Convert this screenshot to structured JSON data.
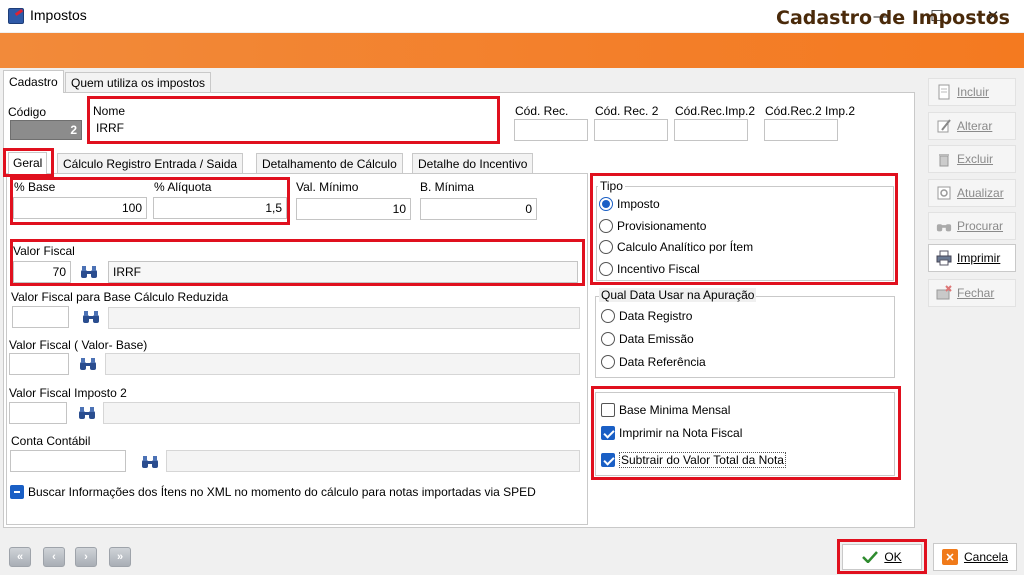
{
  "window": {
    "title": "Impostos",
    "minimize": "—",
    "maximize": "☐",
    "close": "✕"
  },
  "header": {
    "title": "Cadastro de Impostos"
  },
  "main_tabs": [
    {
      "label": "Cadastro"
    },
    {
      "label": "Quem utiliza os impostos"
    }
  ],
  "codigo": {
    "label": "Código",
    "value": "2"
  },
  "nome": {
    "label": "Nome",
    "value": "IRRF"
  },
  "codes": [
    {
      "label": "Cód. Rec."
    },
    {
      "label": "Cód. Rec. 2"
    },
    {
      "label": "Cód.Rec.Imp.2"
    },
    {
      "label": "Cód.Rec.2 Imp.2"
    }
  ],
  "sub_tabs": [
    {
      "label": "Geral"
    },
    {
      "label": "Cálculo Registro Entrada / Saida"
    },
    {
      "label": "Detalhamento de Cálculo"
    },
    {
      "label": "Detalhe do Incentivo"
    }
  ],
  "geral": {
    "base": {
      "label": "% Base",
      "value": "100"
    },
    "aliquota": {
      "label": "% Alíquota",
      "value": "1,5"
    },
    "val_minimo": {
      "label": "Val. Mínimo",
      "value": "10"
    },
    "b_minima": {
      "label": "B. Mínima",
      "value": "0"
    },
    "valor_fiscal": {
      "label": "Valor Fiscal",
      "code": "70",
      "desc": "IRRF"
    },
    "vf_base_reduzida": {
      "label": "Valor Fiscal para Base Cálculo Reduzida",
      "code": "",
      "desc": ""
    },
    "vf_valor_base": {
      "label": "Valor Fiscal ( Valor- Base)",
      "code": "",
      "desc": ""
    },
    "vf_imposto2": {
      "label": "Valor Fiscal Imposto 2",
      "code": "",
      "desc": ""
    },
    "conta_contabil": {
      "label": "Conta Contábil",
      "code": "",
      "desc": ""
    },
    "buscar_xml": {
      "label": "Buscar Informações dos Ítens no XML no momento do cálculo para notas importadas via SPED",
      "checked": true
    }
  },
  "tipo": {
    "title": "Tipo",
    "options": [
      {
        "label": "Imposto",
        "selected": true
      },
      {
        "label": "Provisionamento",
        "selected": false
      },
      {
        "label": "Calculo Analítico por Ítem",
        "selected": false
      },
      {
        "label": "Incentivo Fiscal",
        "selected": false
      }
    ]
  },
  "data_apuracao": {
    "title": "Qual Data Usar na Apuração",
    "options": [
      {
        "label": "Data Registro",
        "selected": false
      },
      {
        "label": "Data Emissão",
        "selected": false
      },
      {
        "label": "Data Referência",
        "selected": false
      }
    ]
  },
  "flags": [
    {
      "label": "Base Minima Mensal",
      "checked": false
    },
    {
      "label": "Imprimir na Nota Fiscal",
      "checked": true
    },
    {
      "label": "Subtrair do Valor Total da Nota",
      "checked": true
    }
  ],
  "side_buttons": [
    {
      "label": "Incluir",
      "icon": "document-icon",
      "enabled": false
    },
    {
      "label": "Alterar",
      "icon": "edit-icon",
      "enabled": false
    },
    {
      "label": "Excluir",
      "icon": "trash-icon",
      "enabled": false
    },
    {
      "label": "Atualizar",
      "icon": "refresh-icon",
      "enabled": false
    },
    {
      "label": "Procurar",
      "icon": "binoculars-icon",
      "enabled": false
    },
    {
      "label": "Imprimir",
      "icon": "printer-icon",
      "enabled": true
    },
    {
      "label": "Fechar",
      "icon": "close-folder-icon",
      "enabled": false
    }
  ],
  "nav": {
    "first": "«",
    "prev": "‹",
    "next": "›",
    "last": "»"
  },
  "footer": {
    "ok": "OK",
    "cancel": "Cancela"
  },
  "colors": {
    "accent_orange": "#f37f2a",
    "highlight_red": "#e0101e",
    "check_blue": "#1a5fc5"
  }
}
